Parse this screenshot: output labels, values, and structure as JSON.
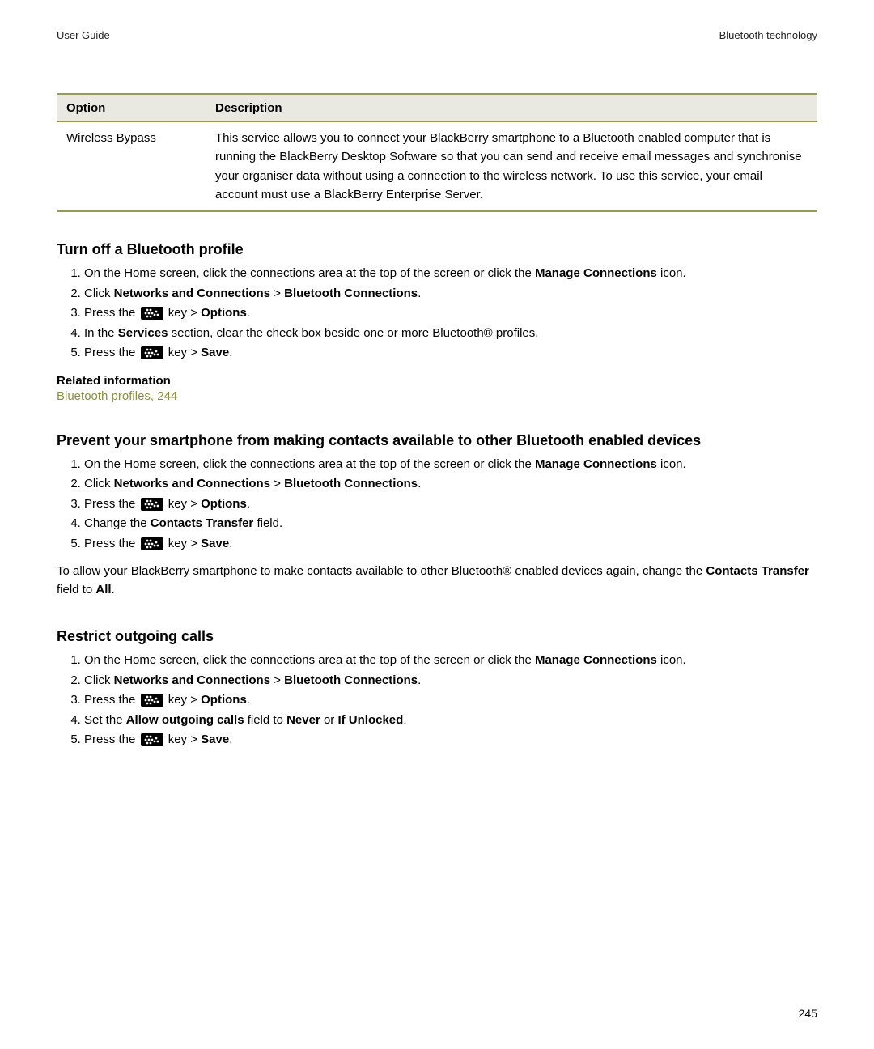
{
  "header": {
    "left": "User Guide",
    "right": "Bluetooth technology"
  },
  "table": {
    "headers": [
      "Option",
      "Description"
    ],
    "row": {
      "option": "Wireless Bypass",
      "description": "This service allows you to connect your BlackBerry smartphone to a Bluetooth enabled computer that is running the BlackBerry Desktop Software so that you can send and receive email messages and synchronise your organiser data without using a connection to the wireless network. To use this service, your email account must use a BlackBerry Enterprise Server."
    }
  },
  "s1": {
    "title": "Turn off a Bluetooth profile",
    "step1a": "On the Home screen, click the connections area at the top of the screen or click the ",
    "step1b": "Manage Connections",
    "step1c": " icon.",
    "step2a": "Click ",
    "step2b": "Networks and Connections",
    "step2c": " > ",
    "step2d": "Bluetooth Connections",
    "step2e": ".",
    "step3a": "Press the ",
    "step3b": " key > ",
    "step3c": "Options",
    "step3d": ".",
    "step4a": "In the ",
    "step4b": "Services",
    "step4c": " section, clear the check box beside one or more Bluetooth® profiles.",
    "step5a": "Press the ",
    "step5b": " key > ",
    "step5c": "Save",
    "step5d": ".",
    "relHeader": "Related information",
    "relLink": "Bluetooth profiles, 244"
  },
  "s2": {
    "title": "Prevent your smartphone from making contacts available to other Bluetooth enabled devices",
    "step1a": "On the Home screen, click the connections area at the top of the screen or click the ",
    "step1b": "Manage Connections",
    "step1c": " icon.",
    "step2a": "Click ",
    "step2b": "Networks and Connections",
    "step2c": " > ",
    "step2d": "Bluetooth Connections",
    "step2e": ".",
    "step3a": "Press the ",
    "step3b": " key > ",
    "step3c": "Options",
    "step3d": ".",
    "step4a": "Change the ",
    "step4b": "Contacts Transfer",
    "step4c": " field.",
    "step5a": "Press the ",
    "step5b": " key > ",
    "step5c": "Save",
    "step5d": ".",
    "para_a": "To allow your BlackBerry smartphone to make contacts available to other Bluetooth® enabled devices again, change the ",
    "para_b": "Contacts Transfer",
    "para_c": " field to ",
    "para_d": "All",
    "para_e": "."
  },
  "s3": {
    "title": "Restrict outgoing calls",
    "step1a": "On the Home screen, click the connections area at the top of the screen or click the ",
    "step1b": "Manage Connections",
    "step1c": " icon.",
    "step2a": "Click ",
    "step2b": "Networks and Connections",
    "step2c": " > ",
    "step2d": "Bluetooth Connections",
    "step2e": ".",
    "step3a": "Press the ",
    "step3b": " key > ",
    "step3c": "Options",
    "step3d": ".",
    "step4a": "Set the ",
    "step4b": "Allow outgoing calls",
    "step4c": " field to ",
    "step4d": "Never",
    "step4e": " or ",
    "step4f": "If Unlocked",
    "step4g": ".",
    "step5a": "Press the ",
    "step5b": " key > ",
    "step5c": "Save",
    "step5d": "."
  },
  "pageNumber": "245"
}
